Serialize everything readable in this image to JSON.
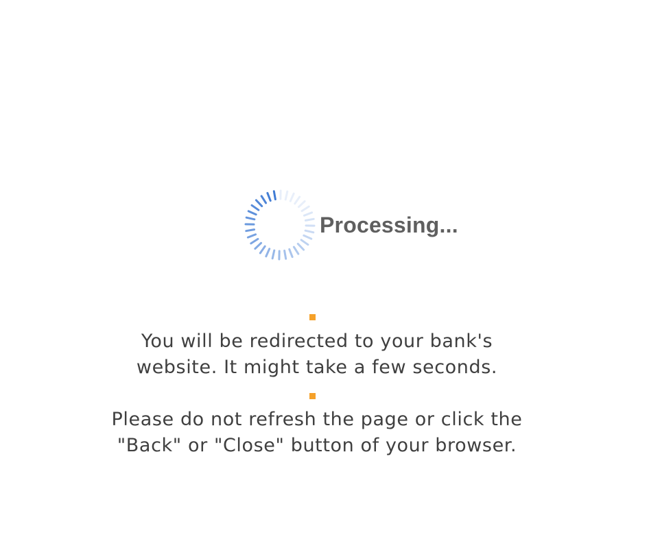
{
  "status": {
    "label": "Processing...",
    "spinner_icon": "loading-spinner-icon",
    "spinner_color": "#3f7bd4",
    "bullet_color": "#f5a12a"
  },
  "messages": [
    {
      "lines": [
        "You will be redirected to your bank's",
        "website. It might take a few seconds."
      ]
    },
    {
      "lines": [
        "Please do not refresh the page or click the",
        "\"Back\" or \"Close\" button of your browser."
      ]
    }
  ]
}
